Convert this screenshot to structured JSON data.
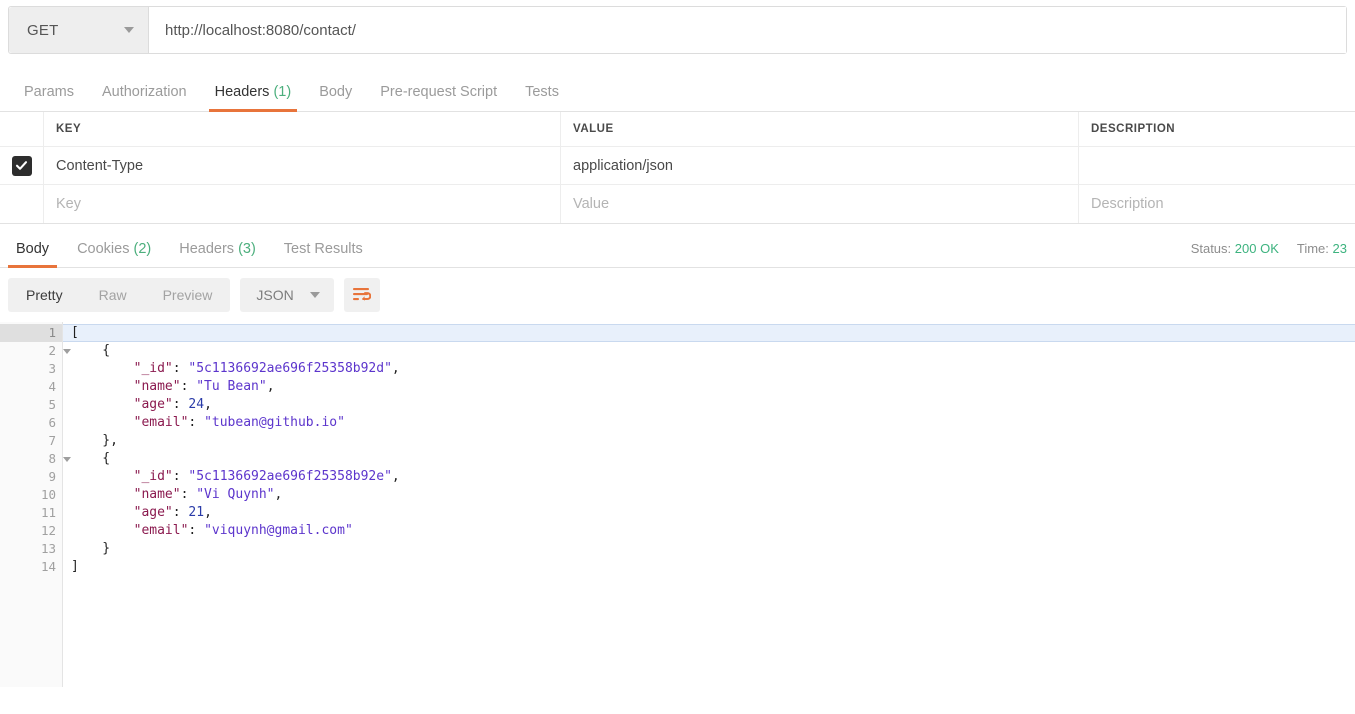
{
  "request": {
    "method": "GET",
    "url": "http://localhost:8080/contact/",
    "tabs": [
      {
        "label": "Params",
        "count": "",
        "active": false
      },
      {
        "label": "Authorization",
        "count": "",
        "active": false
      },
      {
        "label": "Headers",
        "count": "(1)",
        "active": true
      },
      {
        "label": "Body",
        "count": "",
        "active": false
      },
      {
        "label": "Pre-request Script",
        "count": "",
        "active": false
      },
      {
        "label": "Tests",
        "count": "",
        "active": false
      }
    ],
    "headers_table": {
      "columns": [
        "KEY",
        "VALUE",
        "DESCRIPTION"
      ],
      "rows": [
        {
          "checked": true,
          "key": "Content-Type",
          "value": "application/json",
          "description": ""
        }
      ],
      "new_row_placeholders": {
        "key": "Key",
        "value": "Value",
        "description": "Description"
      }
    }
  },
  "response": {
    "tabs": [
      {
        "label": "Body",
        "count": "",
        "active": true
      },
      {
        "label": "Cookies",
        "count": "(2)",
        "active": false
      },
      {
        "label": "Headers",
        "count": "(3)",
        "active": false
      },
      {
        "label": "Test Results",
        "count": "",
        "active": false
      }
    ],
    "status_label": "Status:",
    "status_value": "200 OK",
    "time_label": "Time:",
    "time_value": "23",
    "view_modes": [
      {
        "label": "Pretty",
        "active": true
      },
      {
        "label": "Raw",
        "active": false
      },
      {
        "label": "Preview",
        "active": false
      }
    ],
    "language": "JSON",
    "wrap_button_title": "Word Wrap",
    "body_lines": [
      {
        "num": "1",
        "foldable": true,
        "active": true,
        "tokens": [
          {
            "t": "pun",
            "v": "["
          }
        ]
      },
      {
        "num": "2",
        "foldable": true,
        "active": false,
        "tokens": [
          {
            "t": "pun",
            "v": "    {"
          }
        ]
      },
      {
        "num": "3",
        "foldable": false,
        "active": false,
        "tokens": [
          {
            "t": "key",
            "v": "        \"_id\""
          },
          {
            "t": "pun",
            "v": ": "
          },
          {
            "t": "str",
            "v": "\"5c1136692ae696f25358b92d\""
          },
          {
            "t": "pun",
            "v": ","
          }
        ]
      },
      {
        "num": "4",
        "foldable": false,
        "active": false,
        "tokens": [
          {
            "t": "key",
            "v": "        \"name\""
          },
          {
            "t": "pun",
            "v": ": "
          },
          {
            "t": "str",
            "v": "\"Tu Bean\""
          },
          {
            "t": "pun",
            "v": ","
          }
        ]
      },
      {
        "num": "5",
        "foldable": false,
        "active": false,
        "tokens": [
          {
            "t": "key",
            "v": "        \"age\""
          },
          {
            "t": "pun",
            "v": ": "
          },
          {
            "t": "num",
            "v": "24"
          },
          {
            "t": "pun",
            "v": ","
          }
        ]
      },
      {
        "num": "6",
        "foldable": false,
        "active": false,
        "tokens": [
          {
            "t": "key",
            "v": "        \"email\""
          },
          {
            "t": "pun",
            "v": ": "
          },
          {
            "t": "str",
            "v": "\"tubean@github.io\""
          }
        ]
      },
      {
        "num": "7",
        "foldable": false,
        "active": false,
        "tokens": [
          {
            "t": "pun",
            "v": "    },"
          }
        ]
      },
      {
        "num": "8",
        "foldable": true,
        "active": false,
        "tokens": [
          {
            "t": "pun",
            "v": "    {"
          }
        ]
      },
      {
        "num": "9",
        "foldable": false,
        "active": false,
        "tokens": [
          {
            "t": "key",
            "v": "        \"_id\""
          },
          {
            "t": "pun",
            "v": ": "
          },
          {
            "t": "str",
            "v": "\"5c1136692ae696f25358b92e\""
          },
          {
            "t": "pun",
            "v": ","
          }
        ]
      },
      {
        "num": "10",
        "foldable": false,
        "active": false,
        "tokens": [
          {
            "t": "key",
            "v": "        \"name\""
          },
          {
            "t": "pun",
            "v": ": "
          },
          {
            "t": "str",
            "v": "\"Vi Quynh\""
          },
          {
            "t": "pun",
            "v": ","
          }
        ]
      },
      {
        "num": "11",
        "foldable": false,
        "active": false,
        "tokens": [
          {
            "t": "key",
            "v": "        \"age\""
          },
          {
            "t": "pun",
            "v": ": "
          },
          {
            "t": "num",
            "v": "21"
          },
          {
            "t": "pun",
            "v": ","
          }
        ]
      },
      {
        "num": "12",
        "foldable": false,
        "active": false,
        "tokens": [
          {
            "t": "key",
            "v": "        \"email\""
          },
          {
            "t": "pun",
            "v": ": "
          },
          {
            "t": "str",
            "v": "\"viquynh@gmail.com\""
          }
        ]
      },
      {
        "num": "13",
        "foldable": false,
        "active": false,
        "tokens": [
          {
            "t": "pun",
            "v": "    }"
          }
        ]
      },
      {
        "num": "14",
        "foldable": false,
        "active": false,
        "tokens": [
          {
            "t": "pun",
            "v": "]"
          }
        ]
      }
    ],
    "parsed_body": [
      {
        "_id": "5c1136692ae696f25358b92d",
        "name": "Tu Bean",
        "age": 24,
        "email": "tubean@github.io"
      },
      {
        "_id": "5c1136692ae696f25358b92e",
        "name": "Vi Quynh",
        "age": 21,
        "email": "viquynh@gmail.com"
      }
    ]
  },
  "colors": {
    "accent_orange": "#e8743b",
    "status_green": "#3db37f",
    "json_key": "#8b1a4f",
    "json_string": "#5c35cc",
    "json_number": "#2a3ba8"
  }
}
